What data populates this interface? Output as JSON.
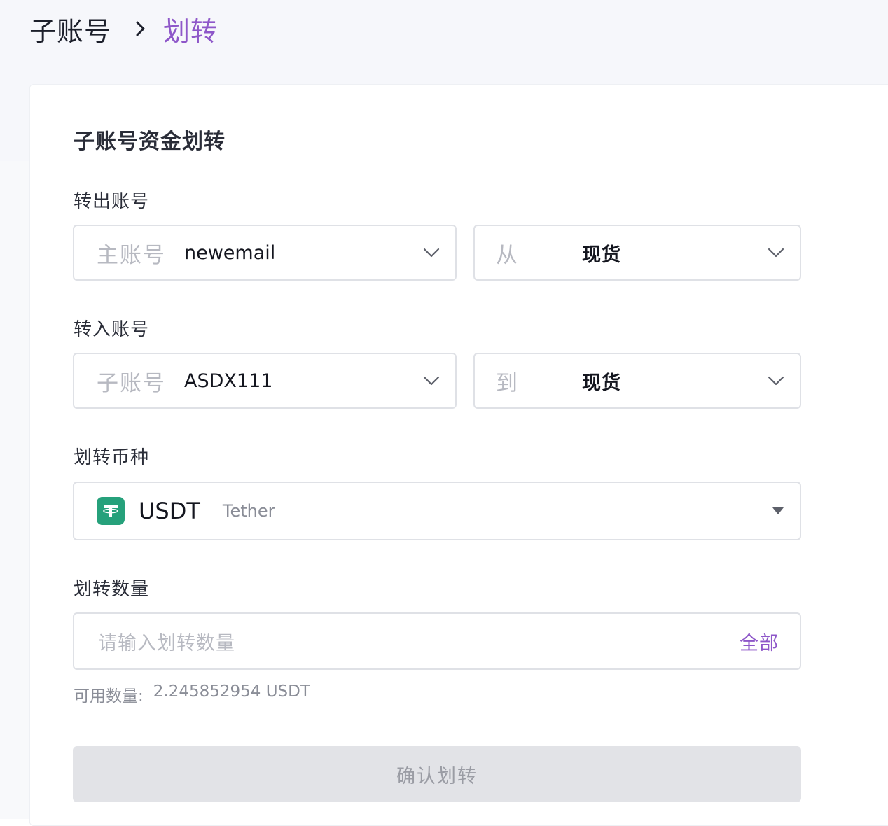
{
  "breadcrumb": {
    "parent": "子账号",
    "current": "划转"
  },
  "card": {
    "title": "子账号资金划转"
  },
  "from": {
    "label": "转出账号",
    "account_prefix": "主账号",
    "account_value": "newemail",
    "wallet_prefix": "从",
    "wallet_value": "现货"
  },
  "to": {
    "label": "转入账号",
    "account_prefix": "子账号",
    "account_value": "ASDX111",
    "wallet_prefix": "到",
    "wallet_value": "现货"
  },
  "coin": {
    "label": "划转币种",
    "symbol": "USDT",
    "name": "Tether",
    "icon": "tether-icon",
    "icon_color": "#26a17b"
  },
  "amount": {
    "label": "划转数量",
    "placeholder": "请输入划转数量",
    "all_label": "全部"
  },
  "available": {
    "label": "可用数量:",
    "value": "2.245852954 USDT"
  },
  "confirm": {
    "label": "确认划转"
  },
  "colors": {
    "accent": "#8e57c9",
    "disabled_button": "#e2e3e7"
  }
}
